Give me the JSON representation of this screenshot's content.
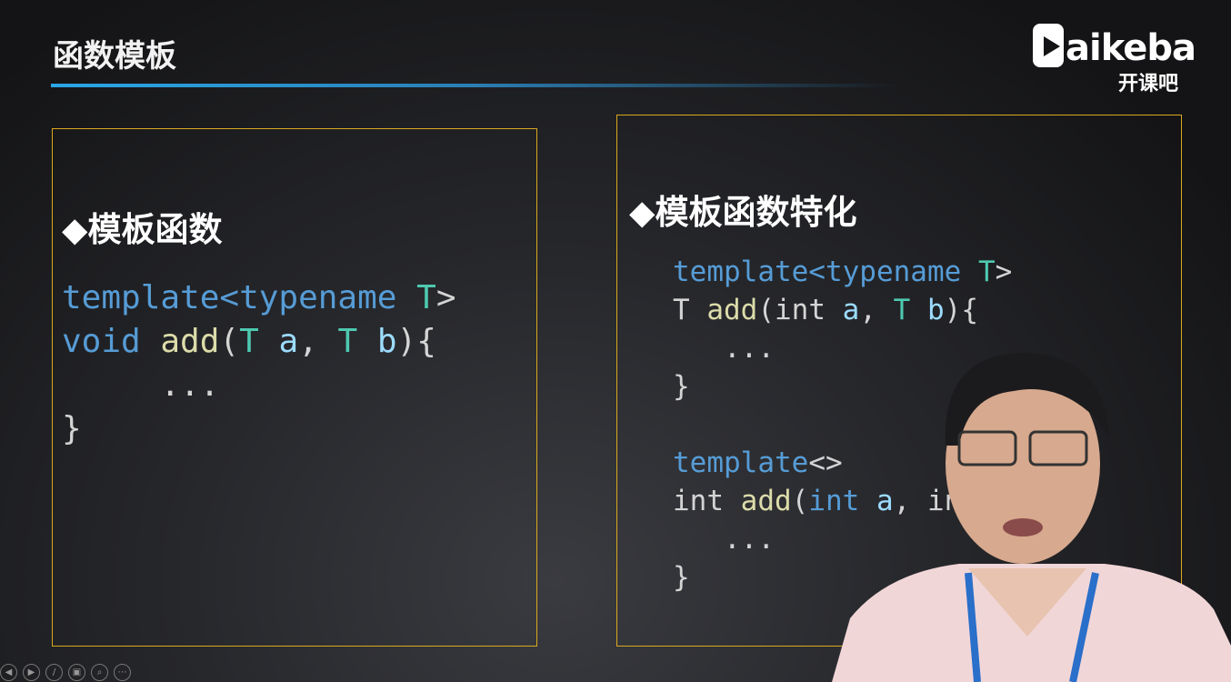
{
  "slide": {
    "title": "函数模板",
    "logo": {
      "word": "aikeba",
      "cn": "开课吧"
    },
    "left": {
      "heading": "◆模板函数",
      "code": [
        [
          [
            "kw",
            "template<typename "
          ],
          [
            "ty",
            "T"
          ],
          [
            "pl",
            ">"
          ]
        ],
        [
          [
            "kw",
            "void "
          ],
          [
            "fn",
            "add"
          ],
          [
            "pl",
            "("
          ],
          [
            "ty",
            "T "
          ],
          [
            "pa",
            "a"
          ],
          [
            "pl",
            ", "
          ],
          [
            "ty",
            "T "
          ],
          [
            "pa",
            "b"
          ],
          [
            "pl",
            "){"
          ]
        ],
        [
          [
            "pl",
            "     ..."
          ]
        ],
        [
          [
            "pl",
            "}"
          ]
        ]
      ]
    },
    "right": {
      "heading": "◆模板函数特化",
      "code": [
        [
          [
            "kw",
            "template<typename "
          ],
          [
            "ty",
            "T"
          ],
          [
            "pl",
            ">"
          ]
        ],
        [
          [
            "pl",
            "T "
          ],
          [
            "fn",
            "add"
          ],
          [
            "pl",
            "(int "
          ],
          [
            "pa",
            "a"
          ],
          [
            "pl",
            ", "
          ],
          [
            "ty",
            "T "
          ],
          [
            "pa",
            "b"
          ],
          [
            "pl",
            "){"
          ]
        ],
        [
          [
            "pl",
            "   ..."
          ]
        ],
        [
          [
            "pl",
            "}"
          ]
        ],
        [
          [
            "pl",
            ""
          ]
        ],
        [
          [
            "kw",
            "template"
          ],
          [
            "pl",
            "<>"
          ]
        ],
        [
          [
            "pl",
            "int "
          ],
          [
            "fn",
            "add"
          ],
          [
            "pl",
            "("
          ],
          [
            "kw",
            "int "
          ],
          [
            "pa",
            "a"
          ],
          [
            "pl",
            ", in"
          ]
        ],
        [
          [
            "pl",
            "   ..."
          ]
        ],
        [
          [
            "pl",
            "}"
          ]
        ]
      ]
    }
  },
  "controls": [
    "previous-icon",
    "next-icon",
    "pen-icon",
    "slides-icon",
    "zoom-icon",
    "more-icon"
  ],
  "colors": {
    "border": "#d9a91e",
    "accent": "#2aa7e8",
    "keyword": "#569cd6",
    "type": "#4ec9b0",
    "function": "#dcdcaa",
    "param": "#9cdcfe"
  }
}
